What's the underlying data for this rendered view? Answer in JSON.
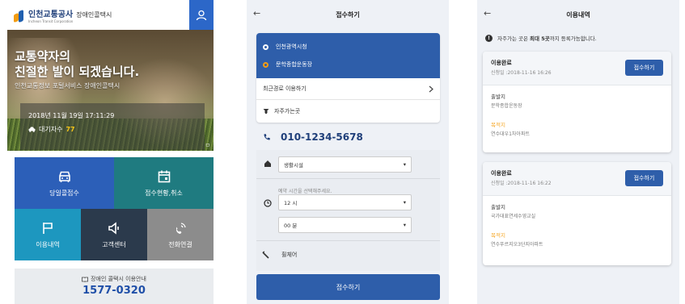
{
  "screen1": {
    "logo": {
      "main": "인천교통공사",
      "sub": "장애인콜택시",
      "eng": "Incheon Transit Corporation"
    },
    "hero": {
      "title_line1": "교통약자의",
      "title_line2": "친절한 발이 되겠습니다.",
      "subtitle": "인천교통정보 포털서비스 장애인콜택시",
      "datetime": "2018년 11월 19일 17:11:29",
      "wait_label": "대기자수",
      "wait_count": "77",
      "corner": "ㅁ"
    },
    "tiles": [
      {
        "label": "당일콜접수",
        "icon": "car-icon"
      },
      {
        "label": "접수현황,취소",
        "icon": "calendar-icon"
      },
      {
        "label": "이용내역",
        "icon": "flag-icon"
      },
      {
        "label": "고객센터",
        "icon": "speaker-icon"
      },
      {
        "label": "전화연결",
        "icon": "phone-ring-icon"
      }
    ],
    "info": {
      "title": "장애인 콜택시 이용안내",
      "phone": "1577-0320"
    },
    "colors": {
      "accent": "#2c67c8",
      "teal": "#1f7b80",
      "cyan": "#1d97bf",
      "dark": "#2b3a4c",
      "gray": "#8c8c8c"
    }
  },
  "screen2": {
    "title": "접수하기",
    "back": "←",
    "origin": "인천광역시청",
    "destination": "문학종합운동장",
    "recent_route": "최근경로 이용하기",
    "favorites": "자주가는곳",
    "phone": "010-1234-5678",
    "purpose_value": "생활시설",
    "time_hint": "예약 시간을 선택해주세요.",
    "hour_value": "12 시",
    "minute_value": "00 분",
    "wheelchair": "휠체어",
    "submit": "접수하기",
    "colors": {
      "primary": "#2e5eaa",
      "origin_dot": "#ffffff",
      "dest_dot": "#f39c12"
    }
  },
  "screen3": {
    "title": "이용내역",
    "back": "←",
    "notice_prefix": "자주가는 곳은 ",
    "notice_bold": "최대 5곳",
    "notice_suffix": "까지 등록가능합니다.",
    "records": [
      {
        "status": "이용완료",
        "date": "신청일 :2018-11-16 16:26",
        "button": "접수하기",
        "origin_label": "출발지",
        "origin": "문학종합운동장",
        "dest_label": "목적지",
        "dest": "연수대우1차아파트"
      },
      {
        "status": "이용완료",
        "date": "신청일 :2018-11-16 16:22",
        "button": "접수하기",
        "origin_label": "출발지",
        "origin": "국가대표연세수영교실",
        "dest_label": "목적지",
        "dest": "연수푸르지오3단지아파트"
      }
    ]
  }
}
